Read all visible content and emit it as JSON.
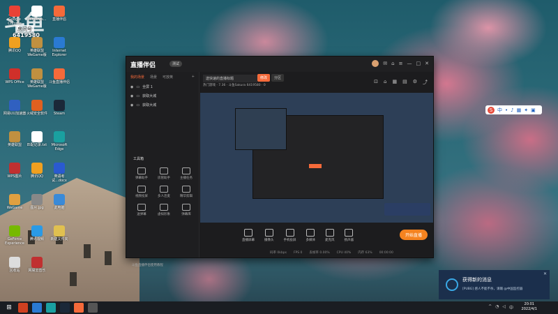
{
  "desktop": {
    "watermark_logo": "斗鱼",
    "watermark_room_label": "房间号",
    "watermark_room_number": "6419580",
    "icons": [
      {
        "label": "Google Chrome",
        "color": "#e94235"
      },
      {
        "label": "Windows...",
        "color": "#ffffff"
      },
      {
        "label": "直播伴侣",
        "color": "#f56a3a"
      },
      {
        "label": "腾讯QQ",
        "color": "#f0a020"
      },
      {
        "label": "英雄联盟 WeGame版",
        "color": "#c09040"
      },
      {
        "label": "Internet Explorer",
        "color": "#2a7ad2"
      },
      {
        "label": "WPS Office",
        "color": "#d0302a"
      },
      {
        "label": "英雄联盟 WeGame版",
        "color": "#c09040"
      },
      {
        "label": "斗鱼直播伴侣",
        "color": "#f56a3a"
      },
      {
        "label": "网易UU加速器",
        "color": "#3060c0"
      },
      {
        "label": "火绒安全软件",
        "color": "#e06020"
      },
      {
        "label": "Steam",
        "color": "#1b2838"
      },
      {
        "label": "英雄联盟",
        "color": "#c09040"
      },
      {
        "label": "匹配记录.txt",
        "color": "#ffffff"
      },
      {
        "label": "Microsoft Edge",
        "color": "#1aa0a0"
      },
      {
        "label": "WPS图片",
        "color": "#c03030"
      },
      {
        "label": "腾讯QQ",
        "color": "#f0a020"
      },
      {
        "label": "英语考试...docx",
        "color": "#2a5ad0"
      },
      {
        "label": "WeGame",
        "color": "#e0a040"
      },
      {
        "label": "图片.jpg",
        "color": "#888888"
      },
      {
        "label": "此电脑",
        "color": "#3a8ad8"
      },
      {
        "label": "GeForce Experience",
        "color": "#76b900"
      },
      {
        "label": "腾讯视频",
        "color": "#2a9ae6"
      },
      {
        "label": "新建文件夹",
        "color": "#e0c050"
      },
      {
        "label": "回收站",
        "color": "#dddddd"
      },
      {
        "label": "网易云音乐",
        "color": "#c03030"
      }
    ]
  },
  "app": {
    "title": "直播伴侣",
    "version_badge": "测试",
    "left_tabs": [
      "我的场景",
      "场景",
      "可放英"
    ],
    "scenes": [
      "全屏 1",
      "获取大城",
      "获取大城"
    ],
    "tools_title": "工具箱",
    "tools": [
      {
        "label": "弹幕助手"
      },
      {
        "label": "房管助手"
      },
      {
        "label": "主播任务"
      },
      {
        "label": "视频投屏"
      },
      {
        "label": "多人连麦"
      },
      {
        "label": "精华剪辑"
      },
      {
        "label": "送弹幕"
      },
      {
        "label": "虚拟形象"
      },
      {
        "label": "弹幕库"
      }
    ],
    "bottom_tip": "斗鱼直播伴侣使用教程",
    "room_title": "送快速的直播标题",
    "edit_button": "修改",
    "category_button": "分区",
    "room_info": "热门游戏 · 7.36 · 斗鱼Sakura 6419580 · 0",
    "controls": [
      {
        "label": "直播屏幕"
      },
      {
        "label": "摄像头"
      },
      {
        "label": "手机投屏"
      },
      {
        "label": "多媒体"
      },
      {
        "label": "麦克风"
      },
      {
        "label": "扬声器"
      }
    ],
    "start_button": "开始直播",
    "status_items": [
      "码率 0kbps",
      "FPS 0",
      "丢帧率 0.00%",
      "CPU 40%",
      "内存 63%",
      "00:00:00"
    ]
  },
  "ime": {
    "letter": "S",
    "mode": "中"
  },
  "toast": {
    "title": "获得新的消息",
    "body": "[PUBG] 感人不能不杀，请输 @中国监控器",
    "close": "✕"
  },
  "taskbar": {
    "time": "20:01",
    "date": "2022/4/1",
    "tray_text": "中"
  }
}
